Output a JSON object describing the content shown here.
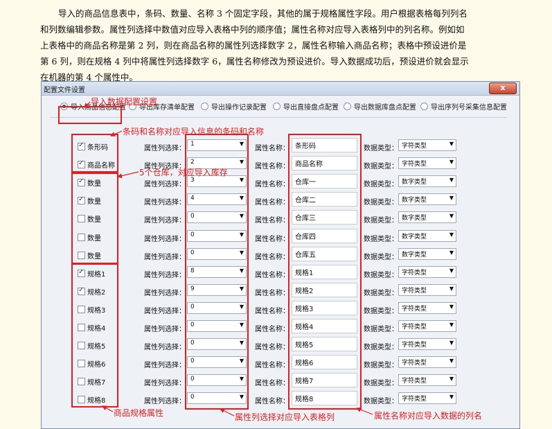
{
  "doc": {
    "paragraph_lines": [
      "导入的商品信息表中，条码、数量、名称 3 个固定字段，其他的属于规格属性字段。用户根据表格每列列名",
      "和列数编辑参数。属性列选择中数值对应导入表格中列的顺序值；属性名称对应导入表格列中的列名称。例如如",
      "上表格中的商品名称是第 2 列，则在商品名称的属性列选择数字 2，属性名称输入商品名称；表格中预设进价是",
      "第 6 列，则在规格 4 列中将属性列选择数字 6，属性名称修改为预设进价。导入数据成功后，预设进价就会显示",
      "在机器的第 4 个属性中。"
    ]
  },
  "window": {
    "title": "配置文件设置",
    "close_label": "x",
    "tabs": [
      {
        "label": "导入商品信息配置",
        "selected": true
      },
      {
        "label": "导出库存清单配置",
        "selected": false
      },
      {
        "label": "导出操作记录配置",
        "selected": false
      },
      {
        "label": "导出直接盘点配置",
        "selected": false
      },
      {
        "label": "导出数据库盘点配置",
        "selected": false
      },
      {
        "label": "导出序列号采集信息配置",
        "selected": false
      }
    ],
    "column_select_label": "属性列选择：",
    "attr_name_label": "属性名称：",
    "data_type_label": "数据类型：",
    "rows": [
      {
        "check": "条形码",
        "checked": true,
        "col": "1",
        "name": "条形码",
        "type": "字符类型"
      },
      {
        "check": "商品名称",
        "checked": true,
        "col": "2",
        "name": "商品名称",
        "type": "字符类型"
      },
      {
        "check": "数量",
        "checked": true,
        "col": "3",
        "name": "仓库一",
        "type": "数字类型"
      },
      {
        "check": "数量",
        "checked": true,
        "col": "4",
        "name": "仓库二",
        "type": "数字类型"
      },
      {
        "check": "数量",
        "checked": false,
        "col": "0",
        "name": "仓库三",
        "type": "数字类型"
      },
      {
        "check": "数量",
        "checked": false,
        "col": "0",
        "name": "仓库四",
        "type": "数字类型"
      },
      {
        "check": "数量",
        "checked": false,
        "col": "0",
        "name": "仓库五",
        "type": "数字类型"
      },
      {
        "check": "规格1",
        "checked": true,
        "col": "8",
        "name": "规格1",
        "type": "字符类型"
      },
      {
        "check": "规格2",
        "checked": true,
        "col": "9",
        "name": "规格2",
        "type": "字符类型"
      },
      {
        "check": "规格3",
        "checked": false,
        "col": "0",
        "name": "规格3",
        "type": "字符类型"
      },
      {
        "check": "规格4",
        "checked": false,
        "col": "0",
        "name": "规格4",
        "type": "字符类型"
      },
      {
        "check": "规格5",
        "checked": false,
        "col": "0",
        "name": "规格5",
        "type": "字符类型"
      },
      {
        "check": "规格6",
        "checked": false,
        "col": "0",
        "name": "规格6",
        "type": "字符类型"
      },
      {
        "check": "规格7",
        "checked": false,
        "col": "0",
        "name": "规格7",
        "type": "字符类型"
      },
      {
        "check": "规格8",
        "checked": false,
        "col": "0",
        "name": "规格8",
        "type": "字符类型"
      }
    ]
  },
  "annotations": {
    "import_config": "导入数据配置设置",
    "barcode_name": "条码和名称对应导入信息的条码和名称",
    "warehouses": "5个仓库，对应导入库存",
    "spec_attrs": "商品规格属性",
    "column_select": "属性列选择对应导入表格列",
    "attr_name": "属性名称对应导入数据的列名"
  },
  "colors": {
    "annotation": "#e02020",
    "page_bg": "#fefae9"
  }
}
